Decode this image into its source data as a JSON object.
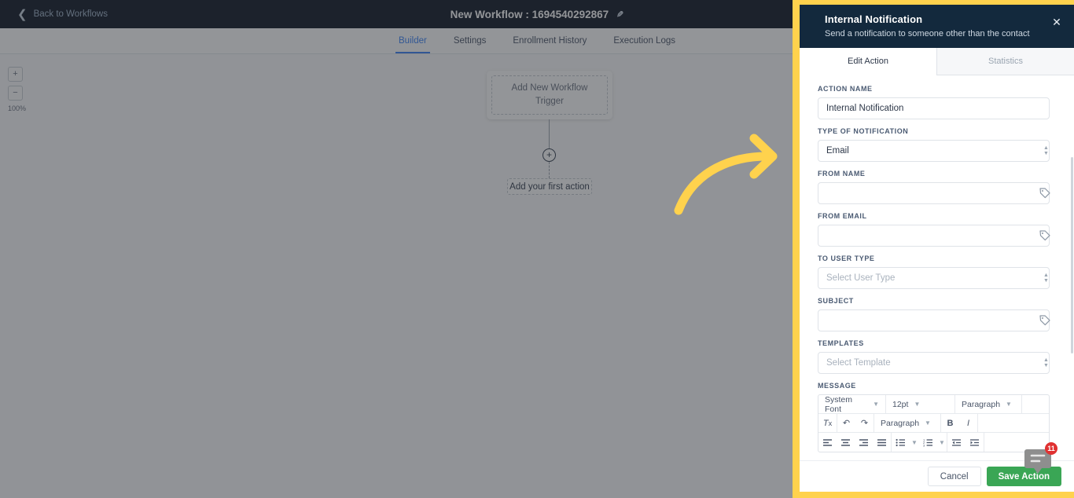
{
  "topbar": {
    "back_label": "Back to Workflows",
    "back_icon": "chevron-left-icon",
    "workflow_title": "New Workflow : 1694540292867",
    "edit_icon": "pencil-icon"
  },
  "nav_tabs": [
    {
      "label": "Builder",
      "active": true
    },
    {
      "label": "Settings",
      "active": false
    },
    {
      "label": "Enrollment History",
      "active": false
    },
    {
      "label": "Execution Logs",
      "active": false
    }
  ],
  "canvas": {
    "zoom_in": "+",
    "zoom_out": "−",
    "zoom_level": "100%",
    "trigger_label": "Add New Workflow Trigger",
    "plus_icon": "plus-circle-icon",
    "first_action_label": "Add your first action"
  },
  "annotation": {
    "arrow_icon": "curved-arrow-right-icon",
    "color": "#ffd24d"
  },
  "panel": {
    "title": "Internal Notification",
    "subtitle": "Send a notification to someone other than the contact",
    "close_icon": "close-icon",
    "header_color": "#13293d",
    "tabs": [
      {
        "label": "Edit Action",
        "active": true
      },
      {
        "label": "Statistics",
        "active": false
      }
    ],
    "fields": {
      "action_name": {
        "label": "ACTION NAME",
        "value": "Internal Notification",
        "placeholder": ""
      },
      "type_of_notification": {
        "label": "TYPE OF NOTIFICATION",
        "value": "Email",
        "icon": "stepper-icon"
      },
      "from_name": {
        "label": "FROM NAME",
        "value": "",
        "placeholder": "",
        "icon": "tag-icon"
      },
      "from_email": {
        "label": "FROM EMAIL",
        "value": "",
        "placeholder": "",
        "icon": "tag-icon"
      },
      "to_user_type": {
        "label": "TO USER TYPE",
        "value": "",
        "placeholder": "Select User Type",
        "icon": "stepper-icon"
      },
      "subject": {
        "label": "SUBJECT",
        "value": "",
        "placeholder": "",
        "icon": "tag-icon"
      },
      "templates": {
        "label": "TEMPLATES",
        "value": "",
        "placeholder": "Select Template",
        "icon": "stepper-icon"
      },
      "message": {
        "label": "MESSAGE"
      }
    },
    "editor": {
      "font_family": "System Font",
      "font_size": "12pt",
      "block_format": "Paragraph",
      "block_format_2": "Paragraph",
      "clear_format_icon": "clear-formatting-icon",
      "undo_icon": "undo-icon",
      "redo_icon": "redo-icon",
      "bold_label": "B",
      "italic_label": "I",
      "align_left_icon": "align-left-icon",
      "align_center_icon": "align-center-icon",
      "align_right_icon": "align-right-icon",
      "align_justify_icon": "align-justify-icon",
      "bullet_list_icon": "bullet-list-icon",
      "numbered_list_icon": "numbered-list-icon",
      "outdent_icon": "outdent-icon",
      "indent_icon": "indent-icon"
    },
    "footer": {
      "cancel_label": "Cancel",
      "save_label": "Save Action",
      "save_color": "#3aa655"
    }
  },
  "chat_widget": {
    "icon": "chat-bubble-icon",
    "badge_count": "11",
    "badge_color": "#e03131"
  }
}
